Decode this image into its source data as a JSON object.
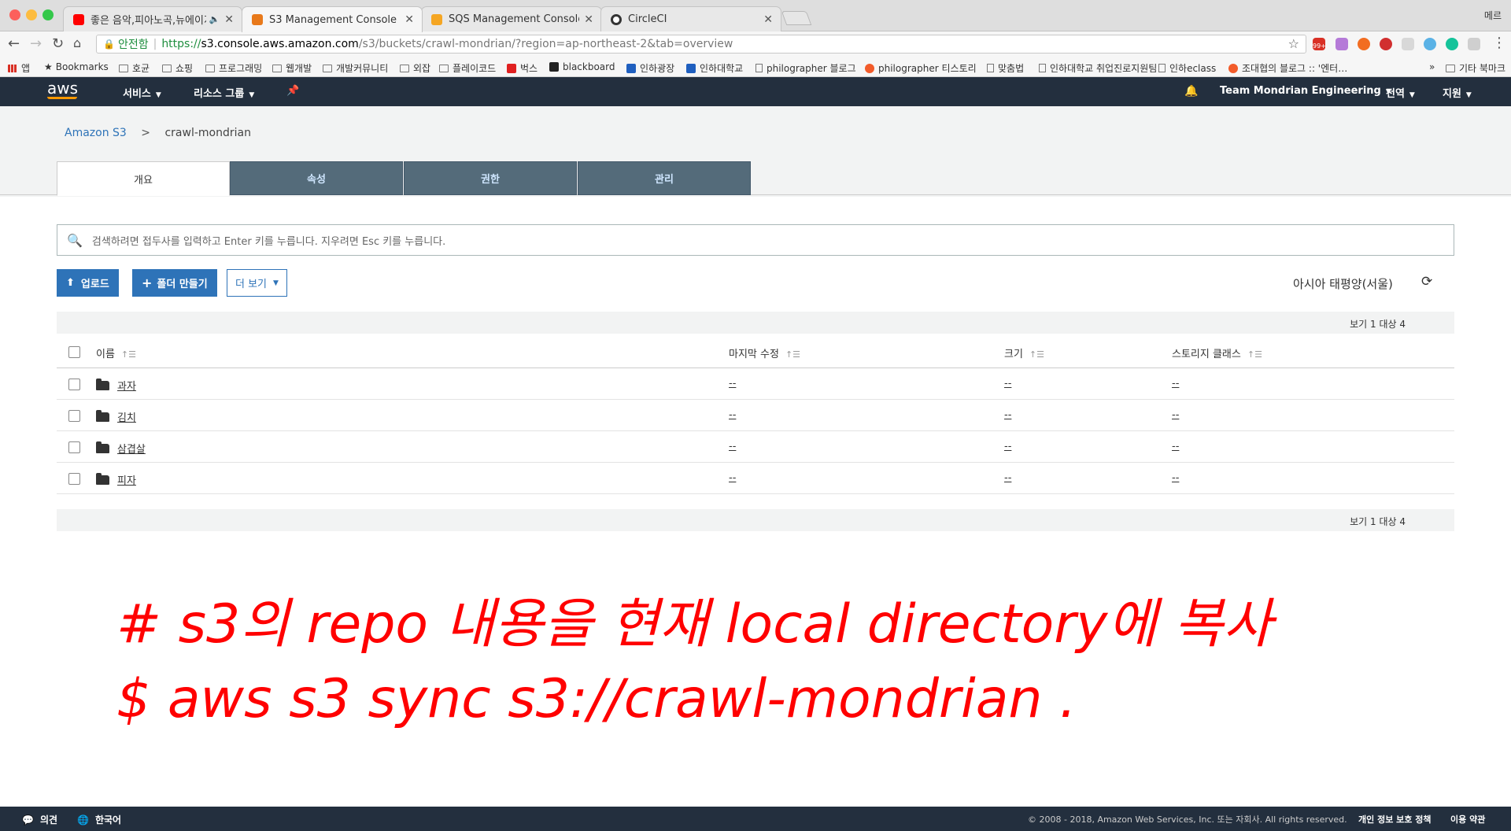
{
  "browser": {
    "tabs": [
      {
        "title": "좋은 음악,피아노곡,뉴에이지 모음",
        "favicon_color": "#ff0000"
      },
      {
        "title": "S3 Management Console",
        "favicon_color": "#e8791a"
      },
      {
        "title": "SQS Management Console",
        "favicon_color": "#f5a623"
      },
      {
        "title": "CircleCI",
        "favicon_color": "#343434"
      }
    ],
    "user": "메르",
    "secure_label": "안전함",
    "url_scheme": "https://",
    "url_host": "s3.console.aws.amazon.com",
    "url_path": "/s3/buckets/crawl-mondrian/?region=ap-northeast-2&tab=overview",
    "bookmarks": [
      "앱",
      "Bookmarks",
      "호균",
      "쇼핑",
      "프로그래밍",
      "웹개발",
      "개발커뮤니티",
      "외잡",
      "플레이코드",
      "벅스",
      "blackboard",
      "인하광장",
      "인하대학교",
      "philographer 블로그",
      "philographer 티스토리",
      "맞춤법",
      "인하대학교 취업진로지원팀",
      "인하eclass",
      "조대협의 블로그 :: '엔터…"
    ],
    "bookmarks_more": "»",
    "other_bookmarks": "기타 북마크",
    "extension_badge": "99+"
  },
  "aws_nav": {
    "logo": "aws",
    "services": "서비스",
    "resource_groups": "리소스 그룹",
    "account": "Team Mondrian Engineering",
    "region": "전역",
    "support": "지원"
  },
  "breadcrumb": {
    "root": "Amazon S3",
    "separator": ">",
    "current": "crawl-mondrian"
  },
  "content_tabs": [
    "개요",
    "속성",
    "권한",
    "관리"
  ],
  "search": {
    "placeholder": "검색하려면 접두사를 입력하고 Enter 키를 누릅니다. 지우려면 Esc 키를 누릅니다."
  },
  "actions": {
    "upload": "업로드",
    "create_folder": "폴더 만들기",
    "more": "더 보기"
  },
  "region_label": "아시아 태평양(서울)",
  "count_label": "보기 1 대상 4",
  "table": {
    "columns": [
      "이름",
      "마지막 수정",
      "크기",
      "스토리지 클래스"
    ],
    "rows": [
      {
        "name": "과자",
        "modified": "--",
        "size": "--",
        "storage": "--"
      },
      {
        "name": "김치",
        "modified": "--",
        "size": "--",
        "storage": "--"
      },
      {
        "name": "삼겹살",
        "modified": "--",
        "size": "--",
        "storage": "--"
      },
      {
        "name": "피자",
        "modified": "--",
        "size": "--",
        "storage": "--"
      }
    ]
  },
  "overlay": {
    "line1": "# s3의 repo 내용을 현재 local directory에 복사",
    "line2": "$ aws s3 sync s3://crawl-mondrian ."
  },
  "footer": {
    "feedback": "의견",
    "language": "한국어",
    "copyright": "© 2008 - 2018, Amazon Web Services, Inc. 또는 자회사. All rights reserved.",
    "privacy": "개인 정보 보호 정책",
    "terms": "이용 약관"
  }
}
